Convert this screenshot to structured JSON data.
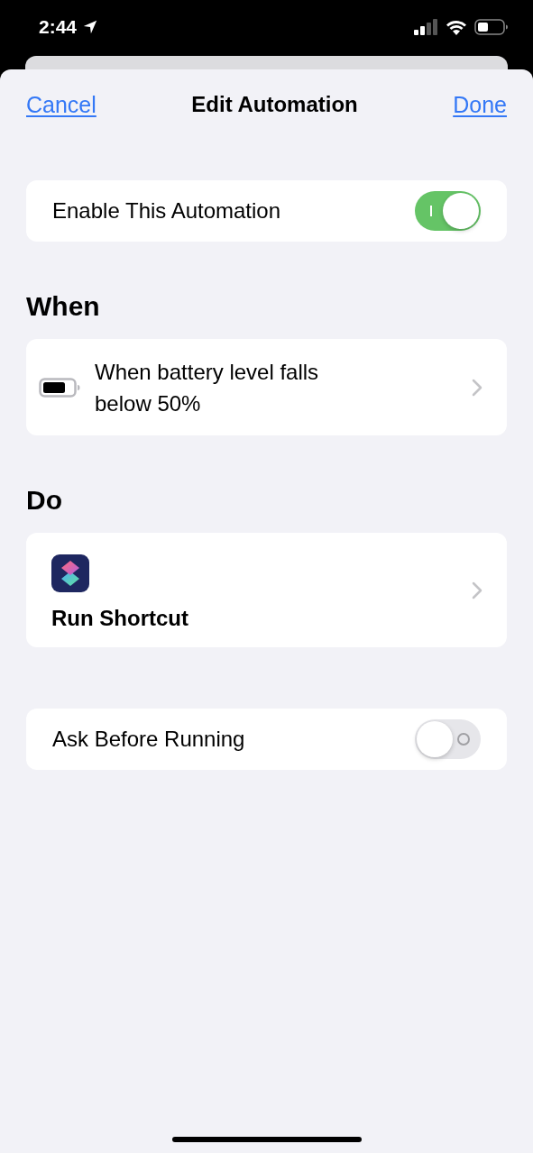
{
  "status_bar": {
    "time": "2:44"
  },
  "nav": {
    "cancel": "Cancel",
    "title": "Edit Automation",
    "done": "Done"
  },
  "enable": {
    "label": "Enable This Automation",
    "on": true
  },
  "sections": [
    {
      "heading": "When",
      "row": {
        "kind": "trigger",
        "text": "When battery level falls below 50%"
      }
    },
    {
      "heading": "Do",
      "row": {
        "kind": "action",
        "text": "Run Shortcut"
      }
    }
  ],
  "ask": {
    "label": "Ask Before Running",
    "on": false
  }
}
